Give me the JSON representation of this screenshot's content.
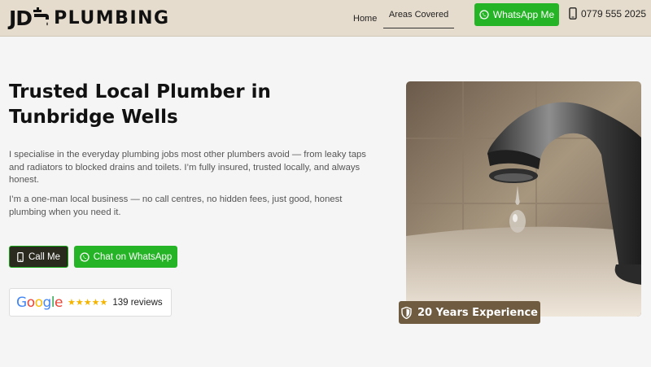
{
  "brand": {
    "initials": "JD",
    "name": "PLUMBING"
  },
  "nav": {
    "home": "Home",
    "areas": "Areas Covered"
  },
  "header": {
    "whatsapp_label": "WhatsApp Me",
    "phone": "0779 555 2025"
  },
  "hero": {
    "title": "Trusted Local Plumber in Tunbridge Wells",
    "paragraph1": "I specialise in the everyday plumbing jobs most other plumbers avoid — from leaky taps and radiators to blocked drains and toilets. I’m fully insured, trusted locally, and always honest.",
    "paragraph2": "I’m a one-man local business — no call centres, no hidden fees, just good, honest plumbing when you need it.",
    "call_label": "Call Me",
    "whatsapp_label": "Chat on WhatsApp"
  },
  "reviews": {
    "provider": "Google",
    "rating": 5,
    "count_label": "139 reviews"
  },
  "badge": {
    "label": "20 Years Experience"
  },
  "colors": {
    "whatsapp_green": "#25b425",
    "header_bg": "#e6dccd",
    "badge_bg": "#6e5b40",
    "call_bg": "#2b2a1f",
    "star": "#f5b400"
  }
}
